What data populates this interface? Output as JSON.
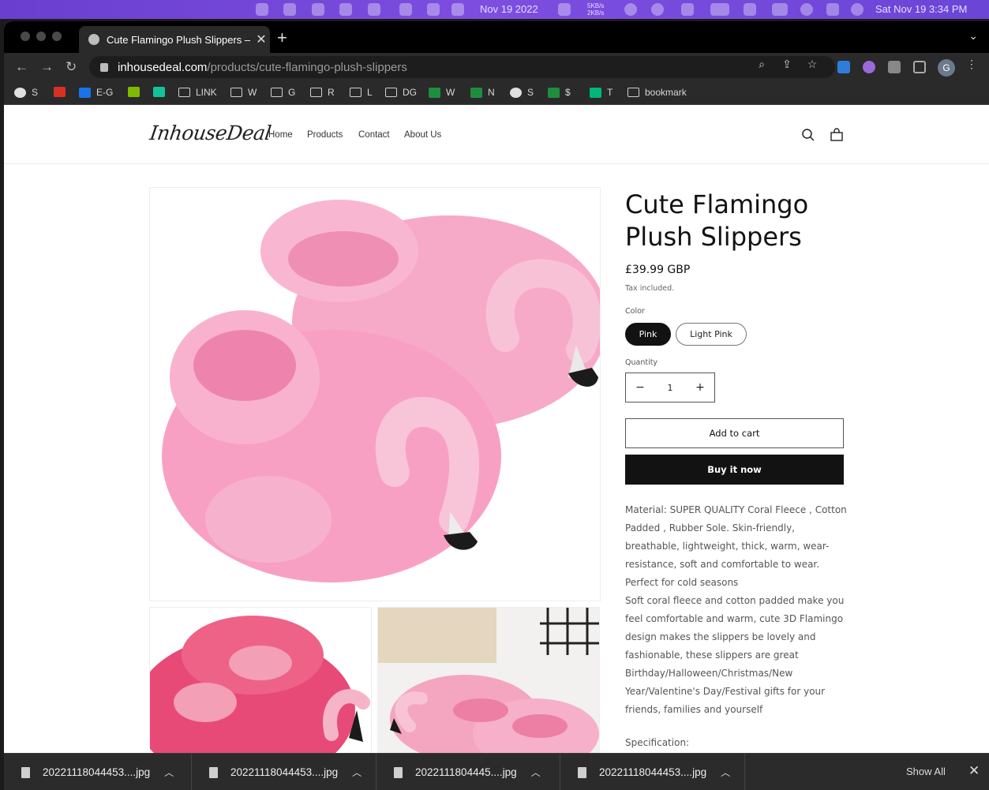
{
  "menubar": {
    "date_left": "Nov 19 2022",
    "net_up": "5KB/s",
    "net_down": "2KB/s",
    "clock": "Sat Nov 19  3:34 PM"
  },
  "browser": {
    "tab_title": "Cute Flamingo Plush Slippers –",
    "url_host": "inhousedeal.com",
    "url_path": "/products/cute-flamingo-plush-slippers",
    "profile_initial": "G",
    "bookmarks": [
      {
        "label": "S",
        "icon": "globe-icon"
      },
      {
        "label": "",
        "icon": "gmail-icon"
      },
      {
        "label": "E-G",
        "icon": "outlook-icon"
      },
      {
        "label": "",
        "icon": "microsoft-icon"
      },
      {
        "label": "",
        "icon": "grammarly-icon"
      },
      {
        "label": "LINK",
        "icon": "folder-icon"
      },
      {
        "label": "W",
        "icon": "folder-icon"
      },
      {
        "label": "G",
        "icon": "folder-icon"
      },
      {
        "label": "R",
        "icon": "folder-icon"
      },
      {
        "label": "L",
        "icon": "folder-icon"
      },
      {
        "label": "DG",
        "icon": "folder-icon"
      },
      {
        "label": "W",
        "icon": "sheets-icon"
      },
      {
        "label": "N",
        "icon": "sheets-icon"
      },
      {
        "label": "S",
        "icon": "globe-icon"
      },
      {
        "label": "$",
        "icon": "sheets-icon"
      },
      {
        "label": "T",
        "icon": "star-icon"
      },
      {
        "label": "bookmark",
        "icon": "folder-icon"
      }
    ]
  },
  "store": {
    "logo": "InhouseDeal",
    "nav": [
      "Home",
      "Products",
      "Contact",
      "About Us"
    ]
  },
  "product": {
    "title": "Cute Flamingo Plush Slippers",
    "price": "£39.99 GBP",
    "tax_note": "Tax included.",
    "color_label": "Color",
    "colors": [
      "Pink",
      "Light Pink"
    ],
    "selected_color": "Pink",
    "quantity_label": "Quantity",
    "quantity": "1",
    "minus": "−",
    "plus": "+",
    "add_to_cart": "Add to cart",
    "buy_now": "Buy it now",
    "description_1": "Material: SUPER QUALITY Coral Fleece , Cotton Padded , Rubber Sole. Skin-friendly, breathable, lightweight, thick, warm, wear-resistance, soft and comfortable to wear. Perfect for cold seasons",
    "description_2": "Soft coral fleece and cotton padded make you feel comfortable and warm, cute 3D Flamingo design makes the slippers be lovely and fashionable, these slippers are great Birthday/Halloween/Christmas/New Year/Valentine's Day/Festival gifts for your friends, families and yourself",
    "spec_heading": "Specification:"
  },
  "downloads": {
    "items": [
      "20221118044453....jpg",
      "20221118044453....jpg",
      "2022111804445....jpg",
      "20221118044453....jpg"
    ],
    "show_all": "Show All"
  },
  "colors": {
    "menubar": "#7448da",
    "accent_dark": "#121212",
    "slipper_pink": "#f4a6c6"
  }
}
